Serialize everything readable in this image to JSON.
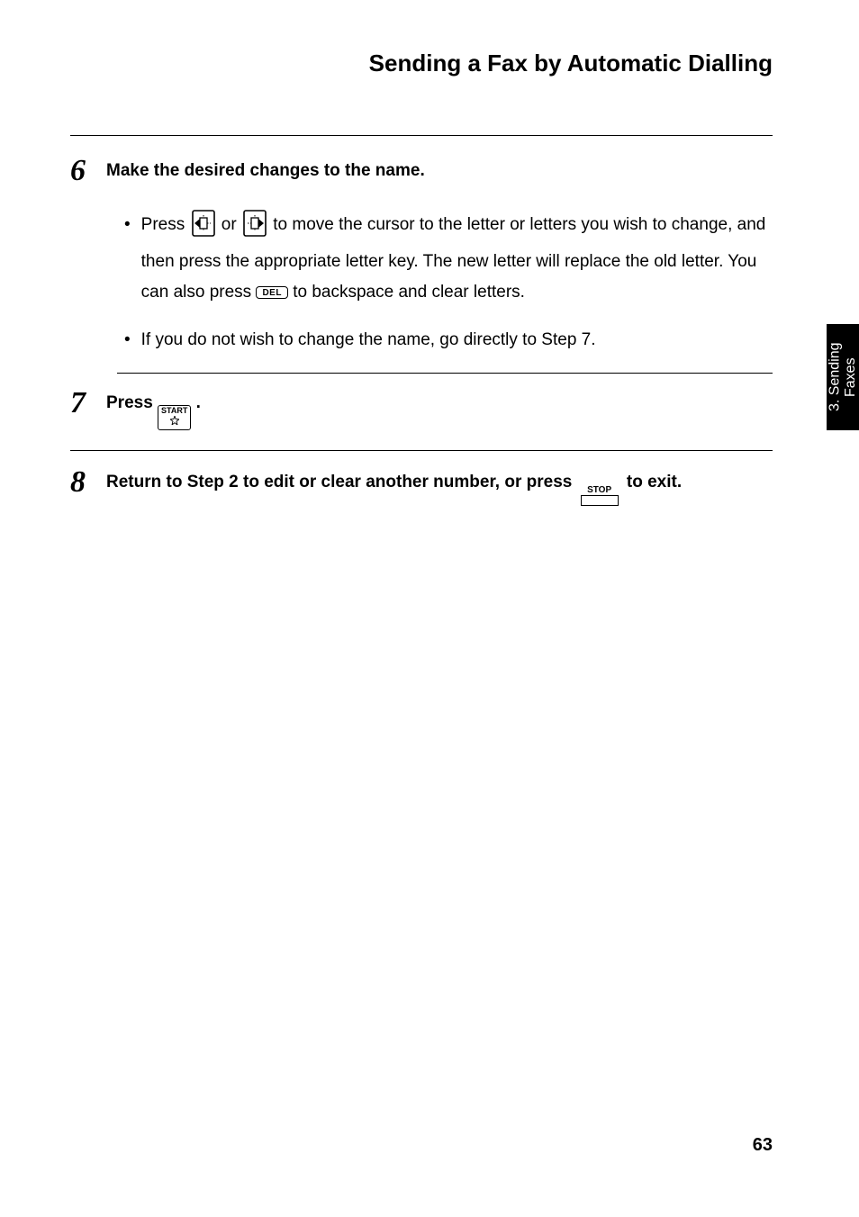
{
  "title": "Sending a Fax by Automatic Dialling",
  "side_tab": "3. Sending\nFaxes",
  "page_number": "63",
  "steps": {
    "s6": {
      "num": "6",
      "head": "Make the desired changes to the name.",
      "bullet1_a": "Press ",
      "bullet1_b": " or ",
      "bullet1_c": " to move the cursor to the letter or letters you wish to change, and then press the appropriate letter key. The new letter will replace the old letter. You can also press ",
      "bullet1_d": " to backspace and clear letters.",
      "bullet2": "If you do not wish to change the name, go directly to Step 7."
    },
    "s7": {
      "num": "7",
      "head_a": "Press ",
      "head_b": "."
    },
    "s8": {
      "num": "8",
      "head_a": "Return to Step 2 to edit or clear another number, or press ",
      "head_b": " to exit."
    }
  },
  "keys": {
    "del": "DEL",
    "start": "START",
    "stop": "STOP"
  }
}
